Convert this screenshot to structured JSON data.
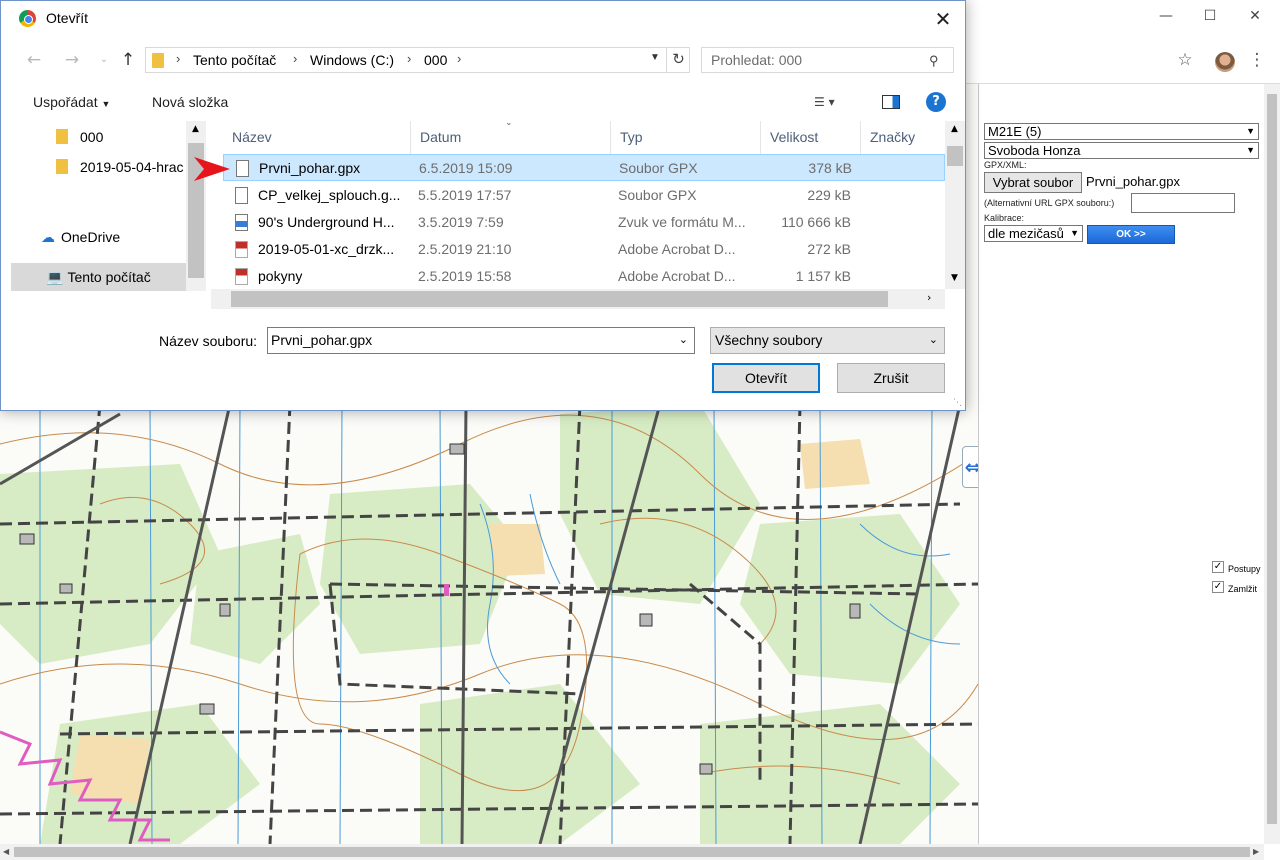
{
  "dialog": {
    "title": "Otevřít",
    "close_icon": "close-icon",
    "breadcrumb": [
      "Tento počítač",
      "Windows (C:)",
      "000"
    ],
    "search_placeholder": "Prohledat: 000",
    "commands": {
      "organize": "Uspořádat",
      "new_folder": "Nová složka"
    },
    "nav_pane": [
      {
        "label": "000",
        "icon": "folder-icon"
      },
      {
        "label": "2019-05-04-hrac",
        "icon": "folder-icon"
      },
      {
        "label": "OneDrive",
        "icon": "cloud-icon"
      },
      {
        "label": "Tento počítač",
        "icon": "computer-icon",
        "selected": true
      }
    ],
    "columns": [
      "Název",
      "Datum",
      "Typ",
      "Velikost",
      "Značky"
    ],
    "files": [
      {
        "name": "Prvni_pohar.gpx",
        "date": "6.5.2019 15:09",
        "type": "Soubor GPX",
        "size": "378 kB",
        "icon": "file-icon",
        "selected": true
      },
      {
        "name": "CP_velkej_splouch.g...",
        "date": "5.5.2019 17:57",
        "type": "Soubor GPX",
        "size": "229 kB",
        "icon": "file-icon"
      },
      {
        "name": "90's Underground H...",
        "date": "3.5.2019 7:59",
        "type": "Zvuk ve formátu M...",
        "size": "110 666 kB",
        "icon": "audio-file-icon"
      },
      {
        "name": "2019-05-01-xc_drzk...",
        "date": "2.5.2019 21:10",
        "type": "Adobe Acrobat D...",
        "size": "272 kB",
        "icon": "pdf-file-icon"
      },
      {
        "name": "pokyny",
        "date": "2.5.2019 15:58",
        "type": "Adobe Acrobat D...",
        "size": "1 157 kB",
        "icon": "pdf-file-icon"
      }
    ],
    "filename_label": "Název souboru:",
    "filename_value": "Prvni_pohar.gpx",
    "filetype_value": "Všechny soubory",
    "open_button": "Otevřít",
    "cancel_button": "Zrušit"
  },
  "panel": {
    "category_select": "M21E (5)",
    "runner_select": "Svoboda Honza",
    "gpx_label": "GPX/XML:",
    "pick_file_button": "Vybrat soubor",
    "picked_file": "Prvni_pohar.gpx",
    "alt_url_label": "(Alternativní URL GPX souboru:)",
    "calibration_label": "Kalibrace:",
    "calibration_select": "dle mezičasů",
    "ok_button": "OK >>",
    "checkboxes": [
      {
        "label": "Postupy",
        "checked": true
      },
      {
        "label": "Zamlžit",
        "checked": true
      }
    ]
  },
  "colors": {
    "accent": "#0078d7",
    "selection": "#cce8ff",
    "ok_button": "#2a79e0"
  }
}
